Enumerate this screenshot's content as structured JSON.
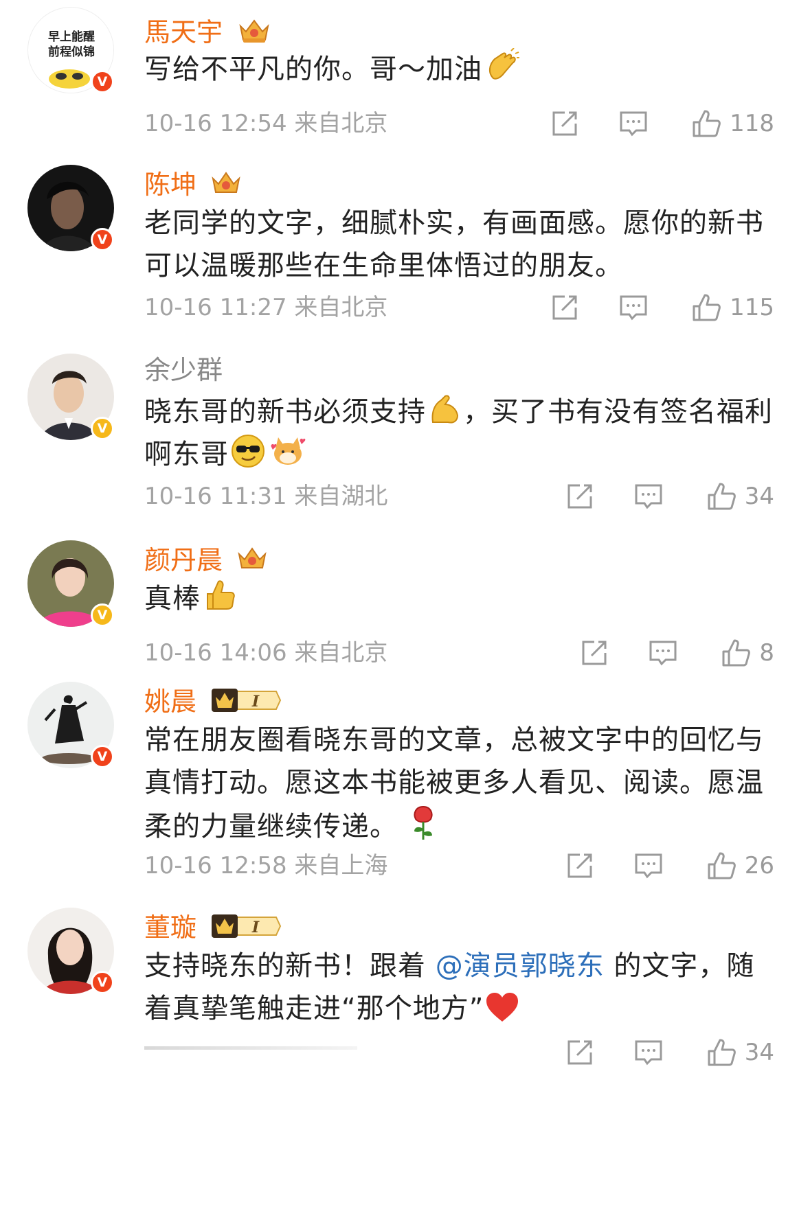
{
  "comments": [
    {
      "username": "馬天宇",
      "avatar_text_line1": "早上能醒",
      "avatar_text_line2": "前程似锦",
      "content": "写给不平凡的你。哥～加油",
      "time": "10-16 12:54",
      "location": "来自北京",
      "likes": "118",
      "verified": "red"
    },
    {
      "username": "陈坤",
      "content": "老同学的文字，细腻朴实，有画面感。愿你的新书可以温暖那些在生命里体悟过的朋友。",
      "time": "10-16 11:27",
      "location": "来自北京",
      "likes": "115",
      "verified": "red"
    },
    {
      "username": "余少群",
      "content_a": "晓东哥的新书必须支持",
      "content_b": "，买了书有没有签名福利啊东哥",
      "time": "10-16 11:31",
      "location": "来自湖北",
      "likes": "34",
      "verified": "gold"
    },
    {
      "username": "颜丹晨",
      "content": "真棒",
      "time": "10-16 14:06",
      "location": "来自北京",
      "likes": "8",
      "verified": "gold"
    },
    {
      "username": "姚晨",
      "content": "常在朋友圈看晓东哥的文章，总被文字中的回忆与真情打动。愿这本书能被更多人看见、阅读。愿温柔的力量继续传递。",
      "time": "10-16 12:58",
      "location": "来自上海",
      "likes": "26",
      "verified": "red",
      "level": "I"
    },
    {
      "username": "董璇",
      "content_a": "支持晓东的新书！跟着 ",
      "mention": "@演员郭晓东",
      "content_b": " 的文字，随着真挚笔触走进“那个地方”",
      "likes": "34",
      "verified": "red",
      "level": "I"
    }
  ],
  "colors": {
    "vip_name": "#f06e16",
    "plain_name": "#888888",
    "mention": "#2d6fba",
    "meta": "#a3a3a3",
    "verified_red": "#f0421b",
    "verified_gold": "#f6b81a"
  },
  "icons": [
    "share-icon",
    "comment-icon",
    "like-icon",
    "crown-badge-icon",
    "level-badge-icon",
    "verified-badge-icon"
  ]
}
